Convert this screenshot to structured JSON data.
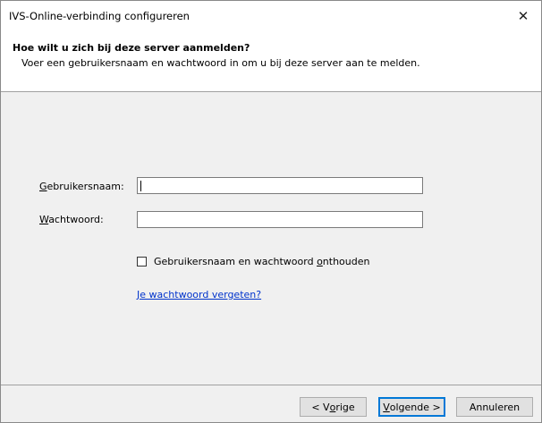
{
  "window": {
    "title": "IVS-Online-verbinding configureren",
    "close_glyph": "✕"
  },
  "header": {
    "heading": "Hoe wilt u zich bij deze server aanmelden?",
    "subheading": "Voer een gebruikersnaam en wachtwoord in om u bij deze server aan te melden."
  },
  "form": {
    "username_label_mnemonic": "G",
    "username_label_rest": "ebruikersnaam:",
    "username_value": "",
    "password_label_mnemonic": "W",
    "password_label_rest": "achtwoord:",
    "password_value": "",
    "remember_label_part1": "Gebruikersnaam en wachtwoord ",
    "remember_label_mnemonic": "o",
    "remember_label_part2": "nthouden",
    "remember_checked": false,
    "forgot_link": "Je wachtwoord vergeten?"
  },
  "footer": {
    "back_prefix": "< V",
    "back_mnemonic": "o",
    "back_rest": "rige",
    "next_mnemonic": "V",
    "next_rest": "olgende >",
    "cancel_label": "Annuleren"
  },
  "colors": {
    "link": "#0033cc",
    "default_button_border": "#0078d7"
  }
}
